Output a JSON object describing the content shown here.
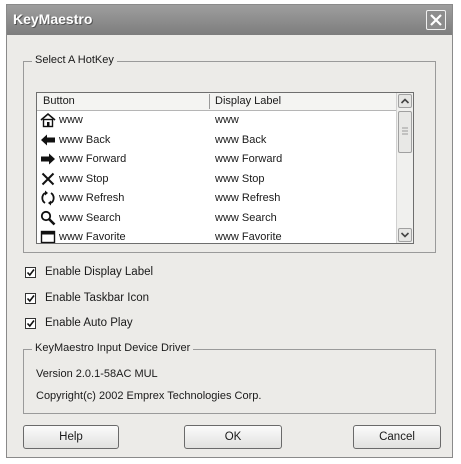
{
  "window": {
    "title": "KeyMaestro"
  },
  "hotkey_group": {
    "legend": "Select A HotKey",
    "columns": [
      "Button",
      "Display Label"
    ],
    "rows": [
      {
        "icon": "home-icon",
        "button": "www",
        "label": "www"
      },
      {
        "icon": "back-arrow-icon",
        "button": "www Back",
        "label": "www Back"
      },
      {
        "icon": "forward-arrow-icon",
        "button": "www Forward",
        "label": "www Forward"
      },
      {
        "icon": "stop-x-icon",
        "button": "www Stop",
        "label": "www Stop"
      },
      {
        "icon": "refresh-icon",
        "button": "www Refresh",
        "label": "www Refresh"
      },
      {
        "icon": "search-magnifier-icon",
        "button": "www Search",
        "label": "www Search"
      },
      {
        "icon": "favorites-icon",
        "button": "www Favorite",
        "label": "www Favorite"
      }
    ]
  },
  "options": {
    "display_label": {
      "label": "Enable Display Label",
      "checked": true
    },
    "taskbar_icon": {
      "label": "Enable Taskbar Icon",
      "checked": true
    },
    "auto_play": {
      "label": "Enable Auto Play",
      "checked": true
    }
  },
  "driver_group": {
    "legend": "KeyMaestro Input Device Driver",
    "version": "Version 2.0.1-58AC MUL",
    "copyright": "Copyright(c) 2002 Emprex Technologies Corp."
  },
  "buttons": {
    "help": "Help",
    "ok": "OK",
    "cancel": "Cancel"
  }
}
